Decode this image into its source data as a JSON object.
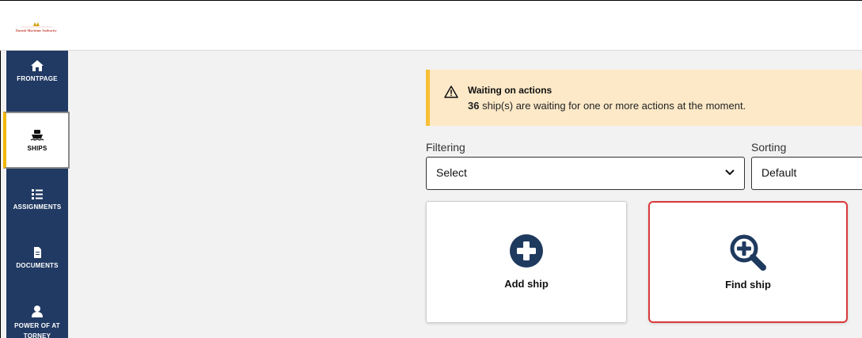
{
  "app": {
    "logo_text": "Danish Maritime Authority"
  },
  "sidebar": {
    "items": [
      {
        "label": "FRONTPAGE",
        "icon": "home-icon"
      },
      {
        "label": "SHIPS",
        "icon": "ship-icon",
        "active": true
      },
      {
        "label": "ASSIGNMENTS",
        "icon": "list-icon"
      },
      {
        "label": "DOCUMENTS",
        "icon": "document-icon"
      },
      {
        "label": "POWER OF AT TORNEY",
        "icon": "person-icon"
      }
    ]
  },
  "alert": {
    "title": "Waiting on actions",
    "count": "36",
    "message": " ship(s) are waiting for one or more actions at the moment.",
    "icon": "warning-icon",
    "accent": "#f7c035",
    "background": "#fde9c8"
  },
  "filtering": {
    "label": "Filtering",
    "value": "Select"
  },
  "sorting": {
    "label": "Sorting",
    "value": "Default"
  },
  "cards": {
    "add": {
      "label": "Add ship",
      "icon": "plus-circle-icon"
    },
    "find": {
      "label": "Find ship",
      "icon": "magnify-plus-icon"
    }
  },
  "colors": {
    "sidebar": "#213a63",
    "highlight": "#d93a3a",
    "icon_dark": "#1f3a5f"
  }
}
